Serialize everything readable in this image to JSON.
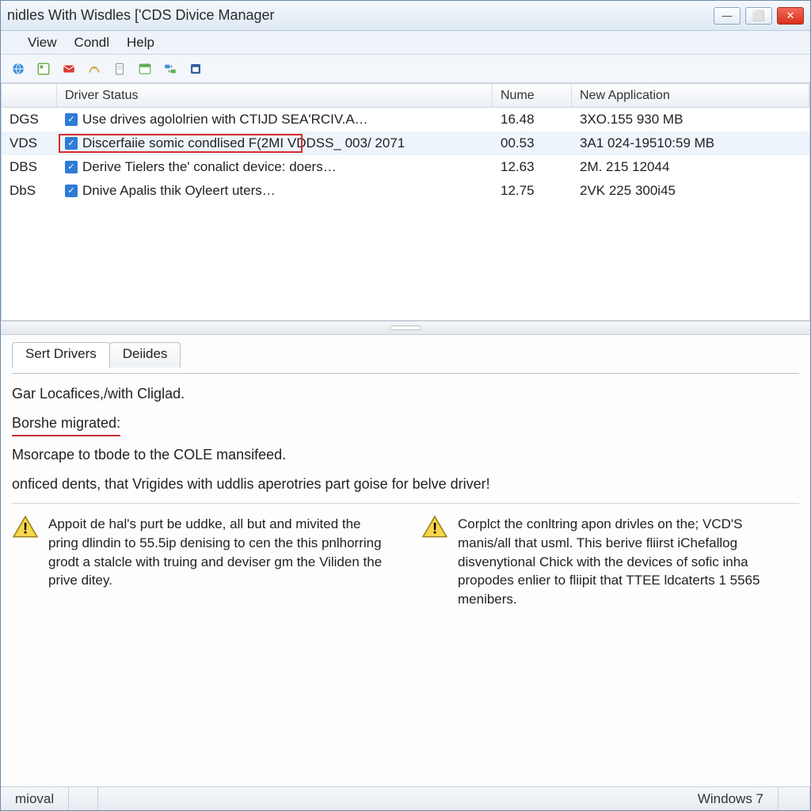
{
  "title": "nidles With Wisdles ['CDS Divice Manager",
  "menubar": [
    "",
    "View",
    "Condl",
    "Help"
  ],
  "toolbar_icons": [
    "globe-icon",
    "layout-icon",
    "envelope-icon",
    "curve-icon",
    "doc-icon",
    "browser-icon",
    "swap-icon",
    "window-icon"
  ],
  "columns": {
    "id": "",
    "status": "Driver Status",
    "nume": "Nume",
    "app": "New Application"
  },
  "rows": [
    {
      "id": "DGS",
      "status": "Use drives agololrien with CTIJD SEA'RCIV.A…",
      "nume": "16.48",
      "app": "3XO.155 930 MB",
      "highlighted": false
    },
    {
      "id": "VDS",
      "status": "Discerfaiie somic condlised F(2MI VDDSS_ 003/ 2071",
      "nume": "00.53",
      "app": "3A1 024-19510:59 MB",
      "highlighted": true
    },
    {
      "id": "DBS",
      "status": "Derive Tielers the' conalict device: doers…",
      "nume": "12.63",
      "app": "2M. 215 12044",
      "highlighted": false
    },
    {
      "id": "DbS",
      "status": "Dnive Apalis thik Oyleert uters…",
      "nume": "12.75",
      "app": "2VK 225 300i45",
      "highlighted": false
    }
  ],
  "tabs": [
    {
      "label": "Sert Drivers",
      "active": true
    },
    {
      "label": "Deiides",
      "active": false
    }
  ],
  "details": {
    "line1": "Gar Locafices,/with Cliglad.",
    "heading": "Borshe migrated:",
    "line2": "Msorcape to tbode to the COLE mansifeed.",
    "line3": "onficed dents, that Vrigides with uddlis aperotries part goise for belve driver!"
  },
  "warnings": [
    "Appoit de hal's purt be uddke, all but and mivited the pring dlindin to 55.5ip denising to cen the this pnlhorring grodt a stalcle with truing and deviser gm the Viliden the prive ditey.",
    "Corplct the conltring apon drivles on the; VCD'S manis/all that usml. This berive fliirst iChefallog disvenytional Chick with the devices of sofic inha propodes enlier to fliipit that TTEE ldcaterts 1 5565 menibers."
  ],
  "statusbar": {
    "left": "mioval",
    "os": "Windows 7"
  }
}
